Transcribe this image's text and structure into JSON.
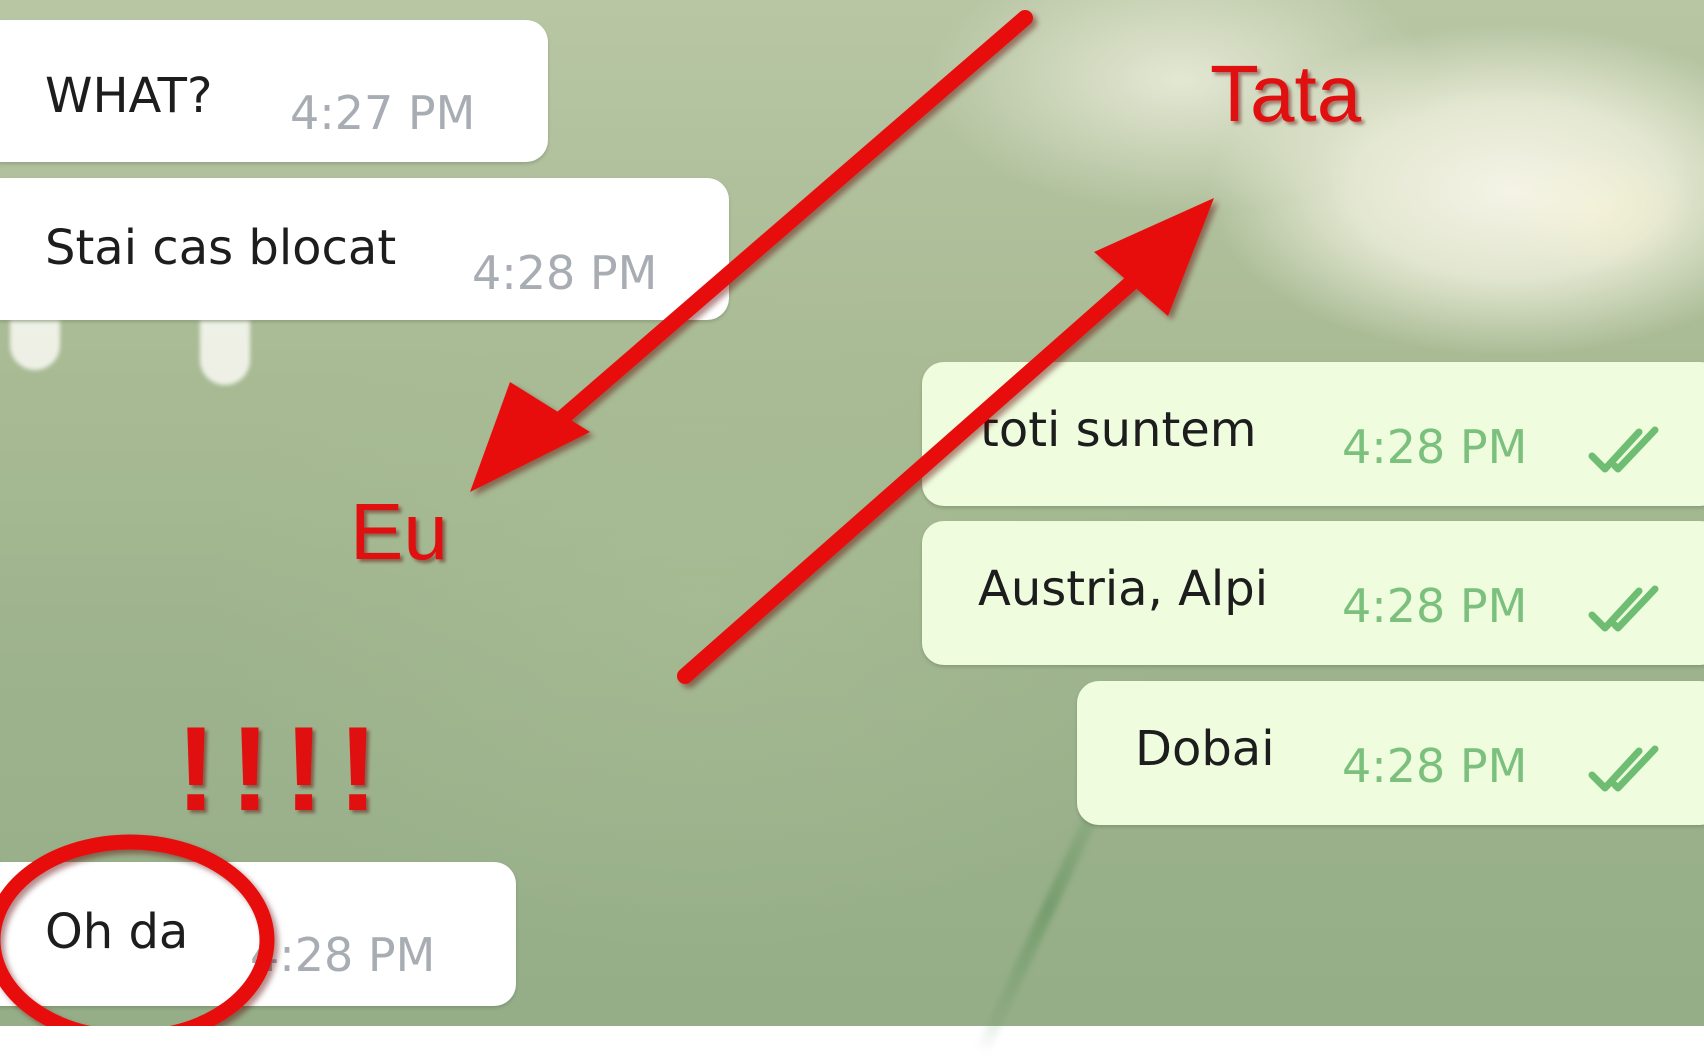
{
  "messages": [
    {
      "text": "WHAT?",
      "time": "4:27 PM"
    },
    {
      "text": "Stai cas blocat",
      "time": "4:28 PM"
    },
    {
      "text": "toti suntem",
      "time": "4:28 PM"
    },
    {
      "text": "Austria, Alpi",
      "time": "4:28 PM"
    },
    {
      "text": "Dobai",
      "time": "4:28 PM"
    },
    {
      "text": "Oh da",
      "time": "4:28 PM"
    }
  ],
  "annotations": {
    "tata": "Tata",
    "eu": "Eu",
    "exclaim": "!!!!"
  },
  "colors": {
    "annotation_red": "#e11010",
    "incoming_bubble": "#ffffff",
    "outgoing_bubble": "#effdde",
    "incoming_time": "#a8adb3",
    "outgoing_time": "#7cc07e"
  },
  "icons": {
    "read_receipt": "double-check-icon"
  }
}
